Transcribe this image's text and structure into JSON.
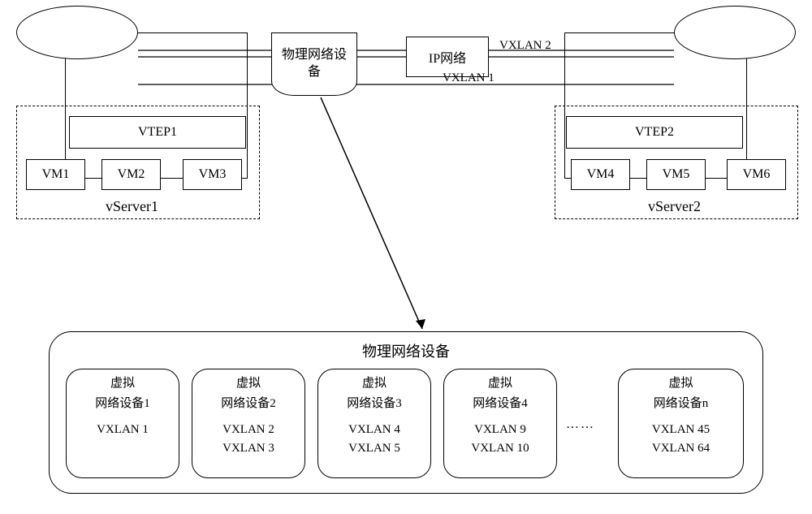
{
  "top": {
    "phys_device": [
      "物理网络设",
      "备"
    ],
    "ip_network": "IP网络",
    "vxlan2": "VXLAN 2",
    "vxlan1": "VXLAN 1"
  },
  "left": {
    "vtep": "VTEP1",
    "vm1": "VM1",
    "vm2": "VM2",
    "vm3": "VM3",
    "vserver": "vServer1"
  },
  "right": {
    "vtep": "VTEP2",
    "vm4": "VM4",
    "vm5": "VM5",
    "vm6": "VM6",
    "vserver": "vServer2"
  },
  "bottom": {
    "title": "物理网络设备",
    "devices": [
      {
        "name": [
          "虚拟",
          "网络设备1"
        ],
        "lines": [
          "VXLAN 1"
        ]
      },
      {
        "name": [
          "虚拟",
          "网络设备2"
        ],
        "lines": [
          "VXLAN 2",
          "VXLAN 3"
        ]
      },
      {
        "name": [
          "虚拟",
          "网络设备3"
        ],
        "lines": [
          "VXLAN 4",
          "VXLAN 5"
        ]
      },
      {
        "name": [
          "虚拟",
          "网络设备4"
        ],
        "lines": [
          "VXLAN 9",
          "VXLAN 10"
        ]
      },
      {
        "name": [
          "虚拟",
          "网络设备n"
        ],
        "lines": [
          "VXLAN 45",
          "VXLAN 64"
        ]
      }
    ],
    "dots": "……"
  }
}
